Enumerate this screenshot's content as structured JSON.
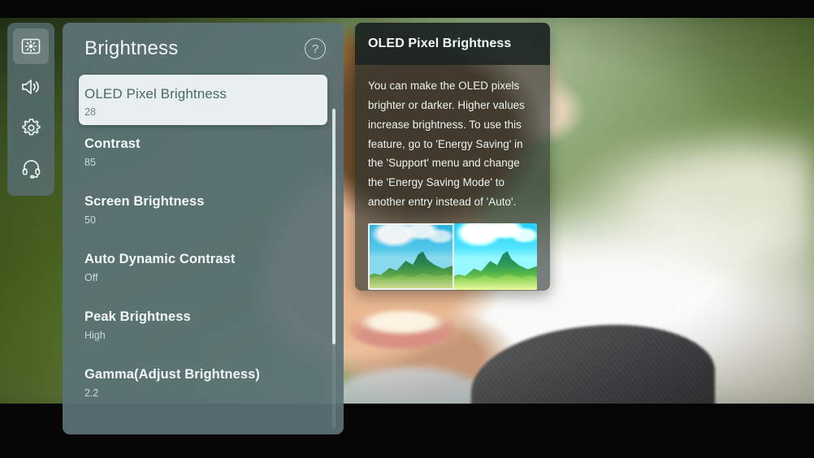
{
  "sidebar": {
    "items": [
      {
        "icon": "picture-brightness-icon",
        "name": "picture",
        "selected": true
      },
      {
        "icon": "speaker-icon",
        "name": "sound",
        "selected": false
      },
      {
        "icon": "gear-icon",
        "name": "general",
        "selected": false
      },
      {
        "icon": "headset-support-icon",
        "name": "support",
        "selected": false
      }
    ]
  },
  "panel": {
    "title": "Brightness",
    "help_icon": "help-circle-icon",
    "help_glyph": "?",
    "items": [
      {
        "label": "OLED Pixel Brightness",
        "value": "28",
        "selected": true
      },
      {
        "label": "Contrast",
        "value": "85",
        "selected": false
      },
      {
        "label": "Screen Brightness",
        "value": "50",
        "selected": false
      },
      {
        "label": "Auto Dynamic Contrast",
        "value": "Off",
        "selected": false
      },
      {
        "label": "Peak Brightness",
        "value": "High",
        "selected": false
      },
      {
        "label": "Gamma(Adjust Brightness)",
        "value": "2.2",
        "selected": false
      }
    ]
  },
  "info": {
    "title": "OLED Pixel Brightness",
    "body": "You can make the OLED pixels brighter or darker. Higher values increase brightness. To use this feature, go to 'Energy Saving' in the 'Support' menu and change the 'Energy Saving Mode' to another entry instead of 'Auto'.",
    "comparison_caption_left": "",
    "comparison_caption_right": ""
  },
  "colors": {
    "panel_bg": "#5b7277",
    "panel_selected_bg": "#e9efef",
    "panel_selected_text": "#4c686d",
    "text_primary": "#f2f7f8",
    "text_secondary": "#cdd9dc",
    "info_header_bg": "#1a2421",
    "info_body_bg": "#263028",
    "letterbox": "#050505"
  }
}
